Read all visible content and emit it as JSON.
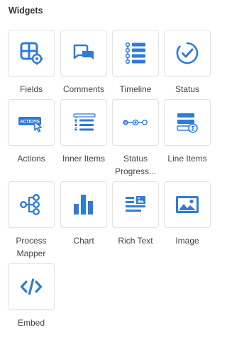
{
  "panel": {
    "title": "Widgets"
  },
  "accent_color": "#2f7bd8",
  "widgets": [
    {
      "label": "Fields",
      "icon": "fields-icon"
    },
    {
      "label": "Comments",
      "icon": "comments-icon"
    },
    {
      "label": "Timeline",
      "icon": "timeline-icon"
    },
    {
      "label": "Status",
      "icon": "status-icon"
    },
    {
      "label": "Actions",
      "icon": "actions-icon",
      "icon_text": "ACTIONS"
    },
    {
      "label": "Inner Items",
      "icon": "inner-items-icon"
    },
    {
      "label": "Status Progress...",
      "icon": "status-progress-icon"
    },
    {
      "label": "Line Items",
      "icon": "line-items-icon",
      "icon_text": "Σ"
    },
    {
      "label": "Process Mapper",
      "icon": "process-mapper-icon"
    },
    {
      "label": "Chart",
      "icon": "chart-icon"
    },
    {
      "label": "Rich Text",
      "icon": "rich-text-icon"
    },
    {
      "label": "Image",
      "icon": "image-icon"
    },
    {
      "label": "Embed",
      "icon": "embed-icon"
    }
  ]
}
